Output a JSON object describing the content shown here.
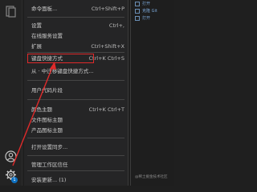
{
  "menu": {
    "items": [
      {
        "label": "命令面板...",
        "shortcut": "Ctrl+Shift+P"
      },
      {
        "label": "设置",
        "shortcut": "Ctrl+,"
      },
      {
        "label": "在线服务设置",
        "shortcut": ""
      },
      {
        "label": "扩展",
        "shortcut": "Ctrl+Shift+X"
      },
      {
        "label": "键盘快捷方式",
        "shortcut": "Ctrl+K Ctrl+S"
      },
      {
        "label": "从 · 中迁移键盘快捷方式...",
        "shortcut": ""
      },
      {
        "label": "用户代码片段",
        "shortcut": ""
      },
      {
        "label": "颜色主题",
        "shortcut": "Ctrl+K Ctrl+T"
      },
      {
        "label": "文件图标主题",
        "shortcut": ""
      },
      {
        "label": "产品图标主题",
        "shortcut": ""
      },
      {
        "label": "打开设置同步...",
        "shortcut": ""
      },
      {
        "label": "管理工作区信任",
        "shortcut": ""
      },
      {
        "label": "安装更新... (1)",
        "shortcut": ""
      }
    ]
  },
  "editor": {
    "lines": [
      "打开",
      "克隆 Git",
      "打开"
    ]
  },
  "activity": {
    "account_icon": "account-icon",
    "manage_icon": "gear-icon",
    "badge_count": "1"
  },
  "watermark": "@稀土掘金技术社区",
  "colors": {
    "highlight": "#e02a2a",
    "badge": "#0e70c0"
  }
}
